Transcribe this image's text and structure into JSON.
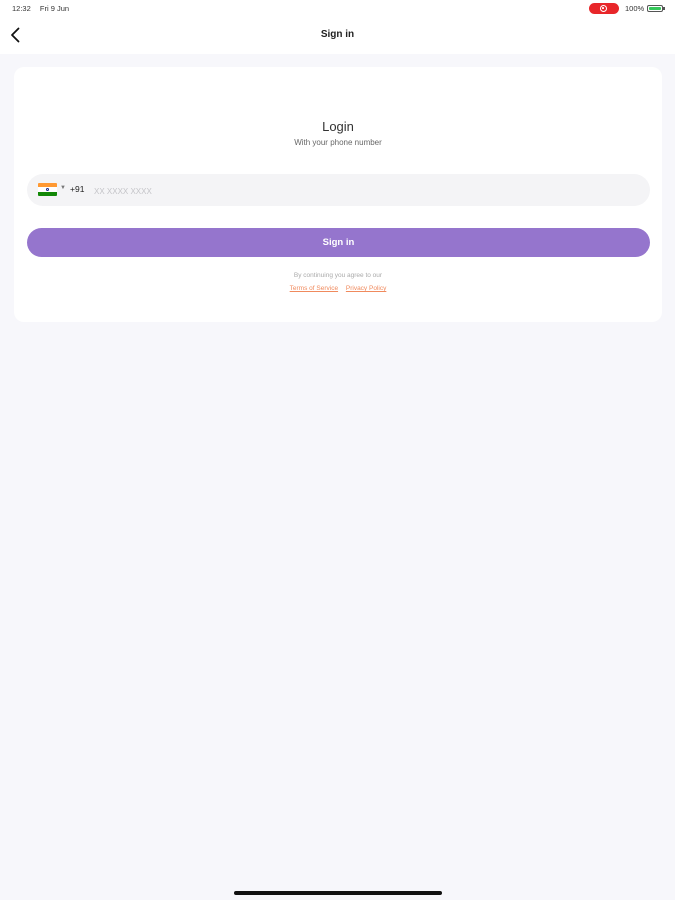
{
  "status_bar": {
    "time": "12:32",
    "date": "Fri 9 Jun",
    "battery": "100%",
    "recording_color": "#e8262a"
  },
  "nav": {
    "title": "Sign in",
    "back_icon": "chevron-left-icon"
  },
  "login": {
    "title": "Login",
    "subtitle": "With your phone number",
    "country_flag": "india-flag-icon",
    "dial_code": "+91",
    "phone_placeholder": "XX XXXX XXXX",
    "phone_value": "",
    "signin_label": "Sign in",
    "terms_prefix": "By continuing you agree to our",
    "terms_link": "Terms of Service",
    "privacy_link": "Privacy Policy"
  },
  "colors": {
    "accent": "#9575cd",
    "link": "#f08a5d",
    "background": "#f7f7fb"
  }
}
